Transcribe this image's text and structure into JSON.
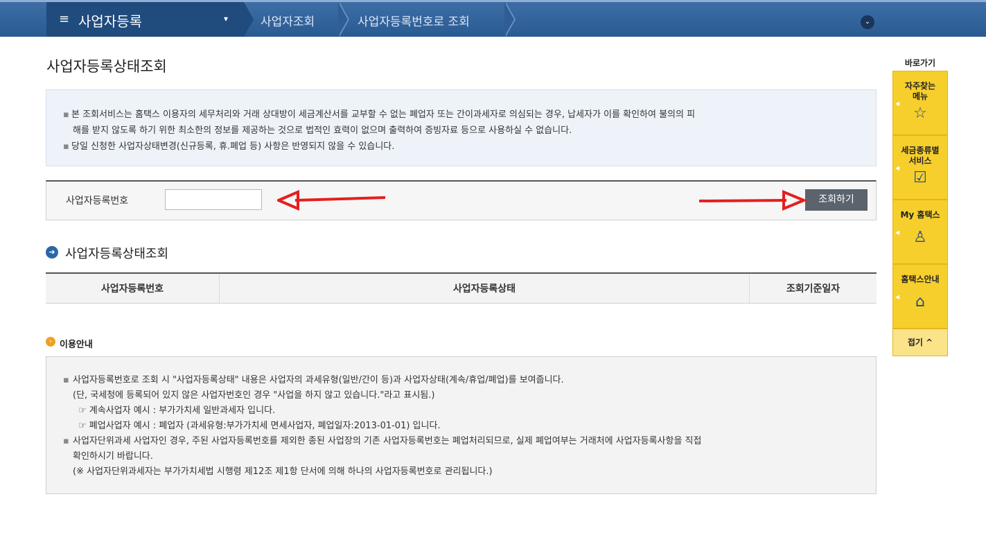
{
  "nav": {
    "menu_icon": "≡",
    "menu_title": "사업자등록",
    "caret": "▾",
    "crumb1": "사업자조회",
    "crumb2": "사업자등록번호로 조회",
    "expand_icon": "⌄"
  },
  "page": {
    "title": "사업자등록상태조회"
  },
  "notice": {
    "bullet": "▪",
    "lines": [
      "본 조회서비스는 홈택스 이용자의 세무처리와 거래 상대방이 세금계산서를 교부할 수 없는 폐업자 또는 간이과세자로 의심되는 경우, 납세자가 이를 확인하여 불의의 피",
      "해를 받지 않도록 하기 위한 최소한의 정보를 제공하는 것으로 법적인 효력이 없으며 출력하여 증빙자료 등으로 사용하실 수 없습니다.",
      "당일 신청한 사업자상태변경(신규등록, 휴.폐업 등) 사항은 반영되지 않을 수 있습니다."
    ]
  },
  "search": {
    "label": "사업자등록번호",
    "input_value": "",
    "button": "조회하기"
  },
  "results": {
    "section_icon": "➜",
    "section_title": "사업자등록상태조회",
    "columns": [
      "사업자등록번호",
      "사업자등록상태",
      "조회기준일자"
    ]
  },
  "guide": {
    "icon": "›",
    "title": "이용안내",
    "bullet": "▪",
    "l1": "사업자등록번호로 조회 시 \"사업자등록상태\" 내용은 사업자의 과세유형(일반/간이 등)과 사업자상태(계속/휴업/폐업)를 보여줍니다.",
    "l2": "(단, 국세청에 등록되어 있지 않은 사업자번호인 경우 \"사업을 하지 않고 있습니다.\"라고 표시됨.)",
    "l3": "☞ 계속사업자 예시 : 부가가치세 일반과세자 입니다.",
    "l4": "☞ 폐업사업자 예시 : 폐업자 (과세유형:부가가치세 면세사업자, 폐업일자:2013-01-01) 입니다.",
    "l5": "사업자단위과세 사업자인 경우, 주된 사업자등록번호를 제외한 종된 사업장의 기존 사업자등록번호는 폐업처리되므로, 실제 폐업여부는 거래처에 사업자등록사항을 직접",
    "l6": "확인하시기 바랍니다.",
    "l7": "(※ 사업자단위과세자는 부가가치세법 시행령 제12조 제1항 단서에 의해 하나의 사업자등록번호로 관리됩니다.)"
  },
  "quick": {
    "head": "바로가기",
    "items": [
      {
        "label1": "자주찾는",
        "label2": "메뉴",
        "icon": "☆"
      },
      {
        "label1": "세금종류별",
        "label2": "서비스",
        "icon": "☑"
      },
      {
        "label1": "My 홈택스",
        "label2": "",
        "icon": "♙"
      },
      {
        "label1": "홈택스안내",
        "label2": "",
        "icon": "⌂"
      }
    ],
    "fold": "접기 ^"
  }
}
